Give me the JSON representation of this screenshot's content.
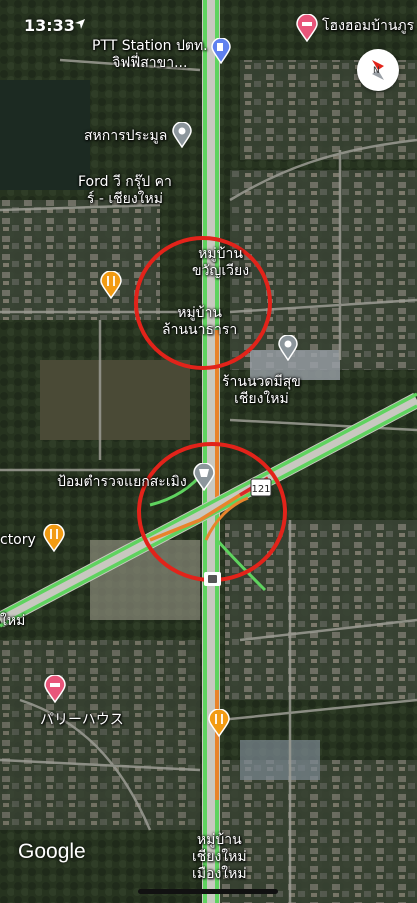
{
  "status_bar": {
    "time": "13:33"
  },
  "top_right_place": {
    "label": "โฮงฮอมบ้านภูร"
  },
  "places": {
    "ptt": {
      "line1": "PTT Station ปตท.",
      "line2": "จิฟฟี่สาขา..."
    },
    "coop": {
      "label": "สหการประมูล"
    },
    "ford": {
      "line1": "Ford วี กรุ๊ป คา",
      "line2": "ร์ - เชียงใหม่"
    },
    "village_khwan": {
      "line1": "หมู่บ้าน",
      "line2": "ขวัญเวียง"
    },
    "village_lanna": {
      "line1": "หมู่บ้าน",
      "line2": "ล้านนาธารา"
    },
    "massage": {
      "line1": "ร้านนวดมีสุข",
      "line2": "เชียงใหม่"
    },
    "police": {
      "label": "ป้อมตำรวจแยกสะเมิง"
    },
    "route_shield": {
      "label": "121"
    },
    "factory": {
      "label": "ctory"
    },
    "edge_left": {
      "label": "ใหม่"
    },
    "pari_house": {
      "label": "パリーハウス"
    },
    "village_cm": {
      "line1": "หมู่บ้าน",
      "line2": "เชียงใหม่",
      "line3": "เมืองใหม่"
    }
  },
  "icons": {
    "restaurant": "fork-knife-icon",
    "gas": "gas-station-icon",
    "pin": "place-pin-icon",
    "hotel": "bed-icon",
    "police": "police-icon",
    "compass": "compass-icon"
  },
  "colors": {
    "traffic_green": "#5fd35f",
    "traffic_orange": "#e8842c",
    "circle_red": "#e2231a",
    "restaurant_orange": "#f29b13",
    "pin_gray": "#8c969c",
    "pin_blue": "#5f80ef",
    "hotel_pink": "#e8557a"
  },
  "attribution": {
    "brand": "Google"
  }
}
